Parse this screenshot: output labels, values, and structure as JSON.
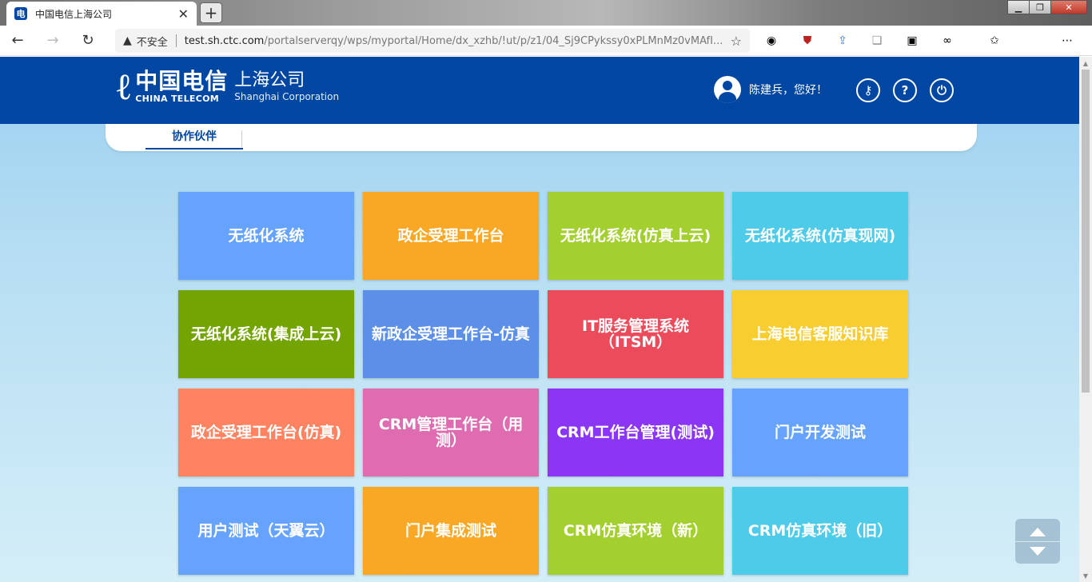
{
  "browser": {
    "tab_title": "中国电信上海公司",
    "tab_favicon": "电",
    "new_tab": "+",
    "security_label": "不安全",
    "url_host": "test.sh.ctc.com",
    "url_rest": "/portalserverqy/wps/myportal/Home/dx_xzhb/!ut/p/z1/04_Sj9CPykssy0xPLMnMz0vMAfI...",
    "nav": {
      "back": "←",
      "forward": "→",
      "reload": "↻"
    }
  },
  "header": {
    "logo_mark": "ℓ",
    "logo_cn": "中国电信",
    "logo_en": "CHINA TELECOM",
    "logo_sub_cn": "上海公司",
    "logo_sub_en": "Shanghai Corporation",
    "greeting": "陈建兵，您好！",
    "icons": [
      "key-icon",
      "help-icon",
      "power-icon"
    ]
  },
  "nav": {
    "tab": "协作伙伴"
  },
  "tiles": [
    {
      "label": "无纸化系统",
      "color": "#66a3ff"
    },
    {
      "label": "政企受理工作台",
      "color": "#f9a825"
    },
    {
      "label": "无纸化系统(仿真上云)",
      "color": "#a3cf2f"
    },
    {
      "label": "无纸化系统(仿真现网)",
      "color": "#4dcbe9"
    },
    {
      "label": "无纸化系统(集成上云)",
      "color": "#74a402"
    },
    {
      "label": "新政企受理工作台-仿真",
      "color": "#5b8fe8"
    },
    {
      "label": "IT服务管理系统（ITSM）",
      "color": "#ec4b5c"
    },
    {
      "label": "上海电信客服知识库",
      "color": "#f7cd30"
    },
    {
      "label": "政企受理工作台(仿真)",
      "color": "#ff8361"
    },
    {
      "label": "CRM管理工作台（用测）",
      "color": "#df6cb0"
    },
    {
      "label": "CRM工作台管理(测试)",
      "color": "#8b36f5"
    },
    {
      "label": "门户开发测试",
      "color": "#66a3ff"
    },
    {
      "label": "用户测试（天翼云）",
      "color": "#66a3ff"
    },
    {
      "label": "门户集成测试",
      "color": "#f9a825"
    },
    {
      "label": "CRM仿真环境（新）",
      "color": "#a3cf2f"
    },
    {
      "label": "CRM仿真环境（旧）",
      "color": "#4dcbe9"
    }
  ]
}
